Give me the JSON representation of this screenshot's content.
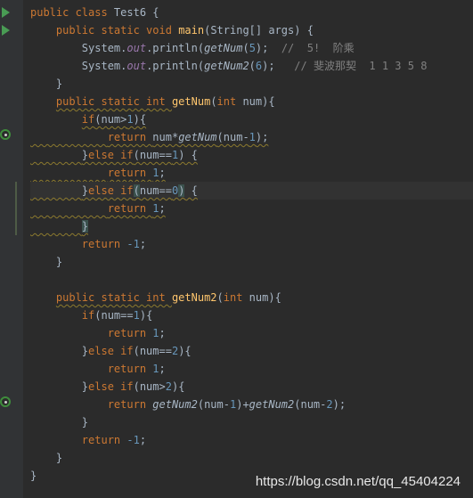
{
  "editor": {
    "theme_colors": {
      "background": "#2b2b2b",
      "gutter": "#313335",
      "keyword": "#cc7832",
      "method_declaration": "#ffc66d",
      "number": "#6897bb",
      "static_field": "#9876aa",
      "comment": "#808080",
      "plain_text": "#a9b7c6",
      "run_icon": "#499c54"
    },
    "code": {
      "l1_kw": "public class ",
      "l1_name": "Test6 {",
      "l2_kw": "public static void ",
      "l2_fn": "main",
      "l2_rest": "(String[] args) {",
      "l3_a": "System.",
      "l3_field": "out",
      "l3_b": ".println(",
      "l3_call": "getNum",
      "l3_c": "(",
      "l3_num": "5",
      "l3_d": ");  ",
      "l3_comment": "//  5!  阶乘",
      "l4_a": "System.",
      "l4_field": "out",
      "l4_b": ".println(",
      "l4_call": "getNum2",
      "l4_c": "(",
      "l4_num": "6",
      "l4_d": ");  ",
      "l4_comment": " // 斐波那契  1 1 3 5 8",
      "l5": "}",
      "l6_kw": "public static int ",
      "l6_fn": "getNum",
      "l6_a": "(",
      "l6_kw2": "int ",
      "l6_b": "num){",
      "l7_kw": "if",
      "l7_a": "(num>",
      "l7_num": "1",
      "l7_b": "){",
      "l8_kw": "return ",
      "l8_a": "num*",
      "l8_call": "getNum",
      "l8_b": "(num-",
      "l8_num": "1",
      "l8_c": ");",
      "l9_a": "}",
      "l9_kw": "else if",
      "l9_b": "(num==",
      "l9_num": "1",
      "l9_c": ") {",
      "l10_kw": "return ",
      "l10_num": "1",
      "l10_a": ";",
      "l11_a": "}",
      "l11_kw": "else if",
      "l11_b": "(",
      "l11_c": "num==",
      "l11_num": "0",
      "l11_d": ")",
      "l11_e": " {",
      "l12_kw": "return ",
      "l12_num": "1",
      "l12_a": ";",
      "l13": "}",
      "l14_kw": "return ",
      "l14_num": "-1",
      "l14_a": ";",
      "l15": "}",
      "l17_kw": "public static int ",
      "l17_fn": "getNum2",
      "l17_a": "(",
      "l17_kw2": "int ",
      "l17_b": "num){",
      "l18_kw": "if",
      "l18_a": "(num==",
      "l18_num": "1",
      "l18_b": "){",
      "l19_kw": "return ",
      "l19_num": "1",
      "l19_a": ";",
      "l20_a": "}",
      "l20_kw": "else if",
      "l20_b": "(num==",
      "l20_num": "2",
      "l20_c": "){",
      "l21_kw": "return ",
      "l21_num": "1",
      "l21_a": ";",
      "l22_a": "}",
      "l22_kw": "else if",
      "l22_b": "(num>",
      "l22_num": "2",
      "l22_c": "){",
      "l23_kw": "return ",
      "l23_call1": "getNum2",
      "l23_a": "(num-",
      "l23_num1": "1",
      "l23_b": ")+",
      "l23_call2": "getNum2",
      "l23_c": "(num-",
      "l23_num2": "2",
      "l23_d": ");",
      "l24": "}",
      "l25_kw": "return ",
      "l25_num": "-1",
      "l25_a": ";",
      "l26": "}",
      "l27": "}"
    }
  },
  "watermark": "https://blog.csdn.net/qq_45404224"
}
